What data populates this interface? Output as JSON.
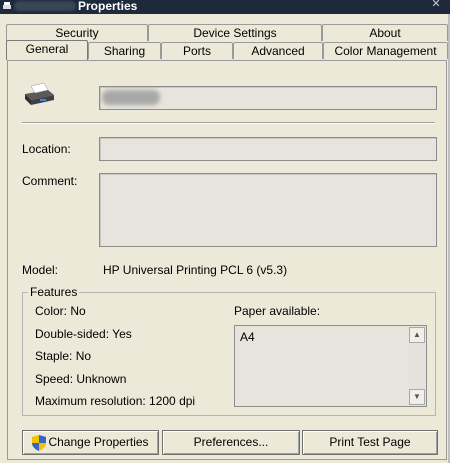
{
  "window": {
    "title": "Properties"
  },
  "tabs_row1": [
    {
      "label": "Security"
    },
    {
      "label": "Device Settings"
    },
    {
      "label": "About"
    }
  ],
  "tabs_row2": [
    {
      "label": "General",
      "active": true
    },
    {
      "label": "Sharing"
    },
    {
      "label": "Ports"
    },
    {
      "label": "Advanced"
    },
    {
      "label": "Color Management"
    }
  ],
  "general": {
    "printer_name": "",
    "location_label": "Location:",
    "location_value": "",
    "comment_label": "Comment:",
    "comment_value": "",
    "model_label": "Model:",
    "model_value": "HP Universal Printing PCL 6 (v5.3)"
  },
  "features": {
    "legend": "Features",
    "color": "Color: No",
    "double_sided": "Double-sided: Yes",
    "staple": "Staple: No",
    "speed": "Speed: Unknown",
    "max_resolution": "Maximum resolution: 1200 dpi",
    "paper_label": "Paper available:",
    "paper_list": [
      "A4"
    ]
  },
  "buttons": {
    "change_properties": "Change Properties",
    "preferences": "Preferences...",
    "print_test_page": "Print Test Page"
  },
  "icons": {
    "printer": "printer-icon",
    "shield": "uac-shield-icon"
  }
}
